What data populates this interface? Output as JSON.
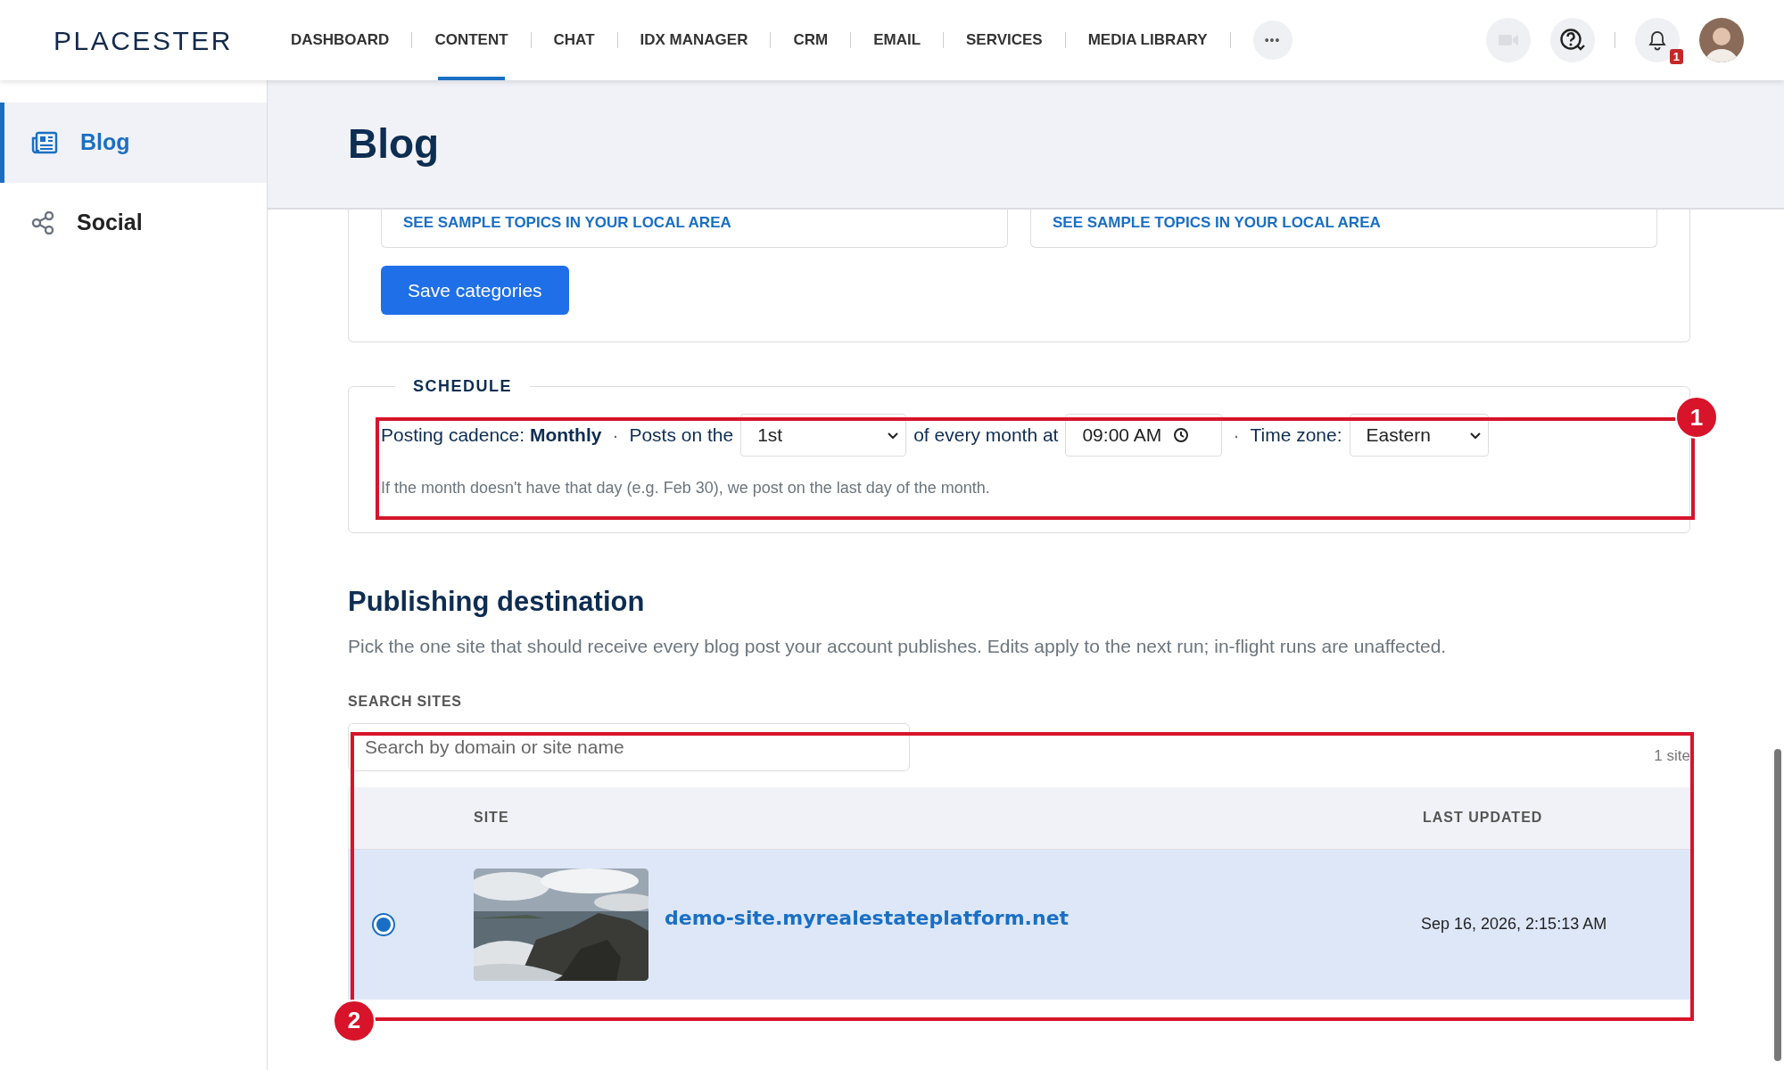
{
  "nav": {
    "logo": "PLACESTER",
    "items": [
      {
        "label": "DASHBOARD",
        "selected": false
      },
      {
        "label": "CONTENT",
        "selected": true
      },
      {
        "label": "CHAT",
        "selected": false
      },
      {
        "label": "IDX MANAGER",
        "selected": false
      },
      {
        "label": "CRM",
        "selected": false
      },
      {
        "label": "EMAIL",
        "selected": false
      },
      {
        "label": "SERVICES",
        "selected": false
      },
      {
        "label": "MEDIA LIBRARY",
        "selected": false
      }
    ],
    "more": "•••",
    "video_disabled": true,
    "notification_count": "1"
  },
  "sidebar": {
    "items": [
      {
        "label": "Blog",
        "kind": "newspaper",
        "selected": true
      },
      {
        "label": "Social",
        "kind": "share",
        "selected": false
      }
    ]
  },
  "page": {
    "title": "Blog"
  },
  "categories": {
    "links": [
      "SEE SAMPLE TOPICS IN YOUR LOCAL AREA",
      "SEE SAMPLE TOPICS IN YOUR LOCAL AREA"
    ],
    "save_button": "Save categories"
  },
  "schedule": {
    "legend": "SCHEDULE",
    "cadence": "Posting cadence: **Monthly**",
    "separators": [
      "·",
      "·"
    ],
    "posts_on_label": "Posts on the",
    "day": "1st",
    "every_month_label": "of every month at",
    "time": "09:00 AM",
    "timezone_label": "Time zone:",
    "timezone": "Eastern",
    "note": "If the month doesn't have that day (e.g. Feb 30), we post on the last day of the month."
  },
  "publishing": {
    "title": "Publishing destination",
    "description": "Pick the one site that should receive every blog post your account publishes. Edits apply to the next run; in-flight runs are unaffected.",
    "search_label": "SEARCH SITES",
    "search": {
      "placeholder": "Search by domain or site name"
    },
    "count": "1 site",
    "columns": [
      "SITE",
      "LAST UPDATED"
    ],
    "sites": [
      {
        "selected": true,
        "domain": "demo-site.myrealestateplatform.net",
        "updated": "Sep 16, 2026, 2:15:13 AM"
      }
    ]
  },
  "annotations": [
    {
      "label": "1"
    },
    {
      "label": "2"
    }
  ]
}
